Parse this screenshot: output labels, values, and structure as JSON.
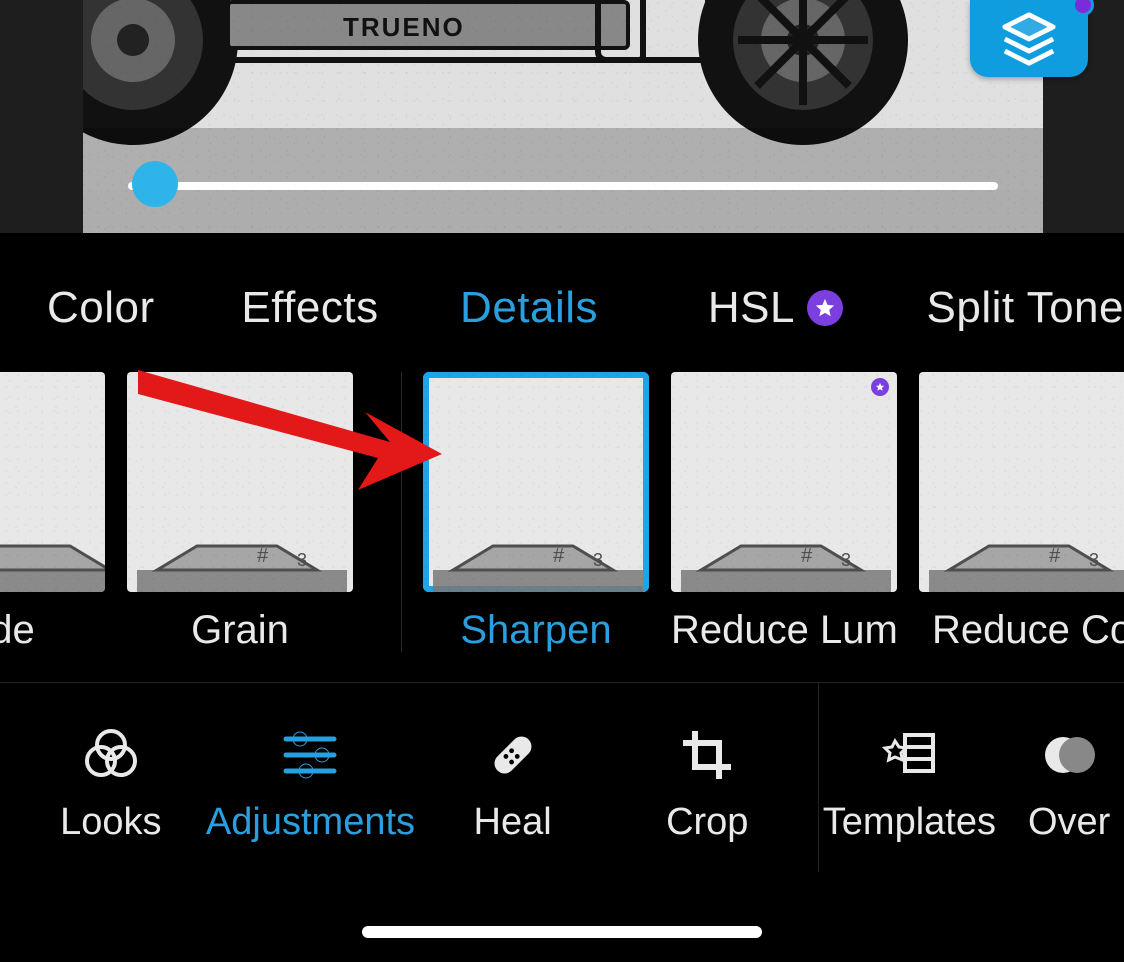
{
  "categories": {
    "color": "Color",
    "effects": "Effects",
    "details": "Details",
    "hsl": "HSL",
    "split": "Split Tone",
    "active": "details"
  },
  "slider": {
    "value": 0
  },
  "thumbs": {
    "de": "de",
    "grain": "Grain",
    "sharpen": "Sharpen",
    "reduce_lumina": "Reduce Lumina",
    "reduce_color": "Reduce Colo",
    "selected": "sharpen"
  },
  "tools": {
    "looks": "Looks",
    "adjustments": "Adjustments",
    "heal": "Heal",
    "crop": "Crop",
    "templates": "Templates",
    "overlays": "Over",
    "active": "adjustments"
  },
  "preview": {
    "plate_text": "TRUENO"
  }
}
